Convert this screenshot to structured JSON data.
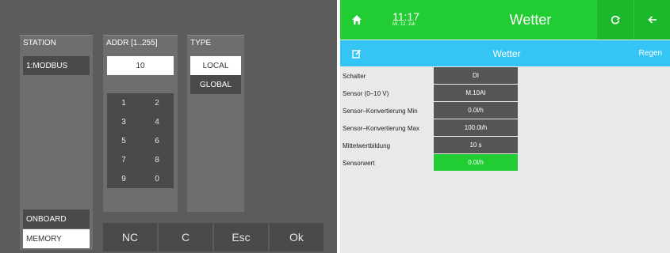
{
  "left_panel": {
    "station": {
      "header": "STATION",
      "items": [
        "1:MODBUS"
      ],
      "bottom_items": [
        "ONBOARD",
        "MEMORY"
      ]
    },
    "addr": {
      "header": "ADDR [1..255]",
      "value": "10",
      "keys": [
        "1",
        "2",
        "3",
        "4",
        "5",
        "6",
        "7",
        "8",
        "9",
        "0"
      ]
    },
    "type": {
      "header": "TYPE",
      "options": [
        "LOCAL",
        "GLOBAL"
      ],
      "selected": "LOCAL"
    },
    "actions": [
      "NC",
      "C",
      "Esc",
      "Ok"
    ]
  },
  "right_panel": {
    "top_bar": {
      "time": "11:17",
      "date": "Mi, 12. Juli",
      "title": "Wetter",
      "icons": [
        "home-icon",
        "refresh-icon",
        "back-arrow-icon"
      ]
    },
    "sub_bar": {
      "title": "Wetter",
      "right_label": "Regen",
      "icon": "edit-icon"
    },
    "rows": [
      {
        "label": "Schalter",
        "value": "DI"
      },
      {
        "label": "Sensor (0–10 V)",
        "value": "M.10AI"
      },
      {
        "label": "Sensor–Konvertierung Min",
        "value": "0.0l/h"
      },
      {
        "label": "Sensor–Konvertierung Max",
        "value": "100.0l/h"
      },
      {
        "label": "Mittelwertbildung",
        "value": "10 s"
      },
      {
        "label": "Sensorwert",
        "value": "0.0l/h",
        "highlight": true
      }
    ]
  },
  "colors": {
    "green": "#22cc33",
    "blue": "#35c5f5",
    "dark_panel": "#5c5c5c",
    "button_dark": "#4a4a4a"
  }
}
